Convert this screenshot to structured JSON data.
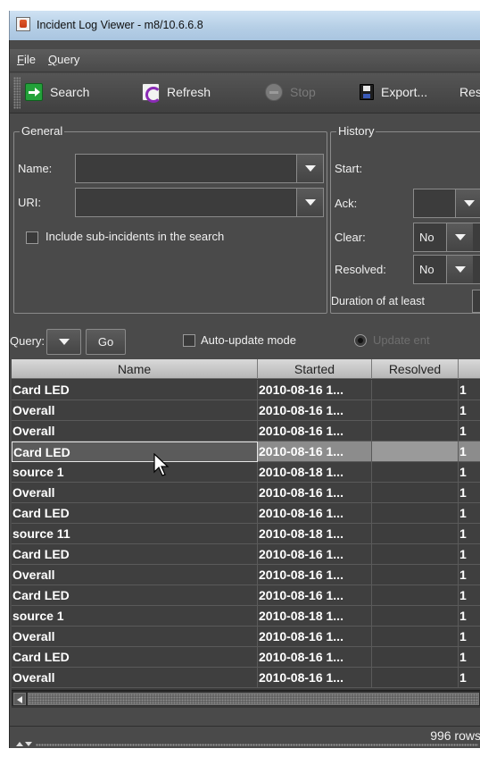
{
  "window": {
    "title": "Incident Log Viewer - m8/10.6.6.8"
  },
  "menu": [
    {
      "label": "File",
      "mnemonic": "F",
      "rest": "ile"
    },
    {
      "label": "Query",
      "mnemonic": "Q",
      "rest": "uery"
    }
  ],
  "toolbar": {
    "search": "Search",
    "refresh": "Refresh",
    "stop": "Stop",
    "export": "Export...",
    "reset": "Res"
  },
  "general": {
    "title": "General",
    "name_label": "Name:",
    "name_value": "",
    "uri_label": "URI:",
    "uri_value": "",
    "include_sub": "Include sub-incidents in the search",
    "include_sub_checked": false
  },
  "history": {
    "title": "History",
    "start_label": "Start:",
    "ack_label": "Ack:",
    "ack_value": "",
    "clear_label": "Clear:",
    "clear_value": "No",
    "resolved_label": "Resolved:",
    "resolved_value": "No",
    "duration_label": "Duration of at least"
  },
  "query": {
    "label": "Query:",
    "go": "Go",
    "auto_update": "Auto-update mode",
    "auto_update_checked": false,
    "update_option": "Update ent"
  },
  "table": {
    "columns": [
      "Name",
      "Started",
      "Resolved",
      ""
    ],
    "rows": [
      {
        "name": "Card LED",
        "started": "2010-08-16 1...",
        "resolved": "",
        "extra": "1"
      },
      {
        "name": "Overall",
        "started": "2010-08-16 1...",
        "resolved": "",
        "extra": "1"
      },
      {
        "name": "Overall",
        "started": "2010-08-16 1...",
        "resolved": "",
        "extra": "1"
      },
      {
        "name": "Card LED",
        "started": "2010-08-16 1...",
        "resolved": "",
        "extra": "1",
        "selected": true
      },
      {
        "name": "source 1",
        "started": "2010-08-18 1...",
        "resolved": "",
        "extra": "1"
      },
      {
        "name": "Overall",
        "started": "2010-08-16 1...",
        "resolved": "",
        "extra": "1"
      },
      {
        "name": "Card LED",
        "started": "2010-08-16 1...",
        "resolved": "",
        "extra": "1"
      },
      {
        "name": "source 11",
        "started": "2010-08-18 1...",
        "resolved": "",
        "extra": "1"
      },
      {
        "name": "Card LED",
        "started": "2010-08-16 1...",
        "resolved": "",
        "extra": "1"
      },
      {
        "name": "Overall",
        "started": "2010-08-16 1...",
        "resolved": "",
        "extra": "1"
      },
      {
        "name": "Card LED",
        "started": "2010-08-16 1...",
        "resolved": "",
        "extra": "1"
      },
      {
        "name": "source 1",
        "started": "2010-08-18 1...",
        "resolved": "",
        "extra": "1"
      },
      {
        "name": "Overall",
        "started": "2010-08-16 1...",
        "resolved": "",
        "extra": "1"
      },
      {
        "name": "Card LED",
        "started": "2010-08-16 1...",
        "resolved": "",
        "extra": "1"
      },
      {
        "name": "Overall",
        "started": "2010-08-16 1...",
        "resolved": "",
        "extra": "1"
      }
    ]
  },
  "status": {
    "row_count": "996 rows"
  },
  "colors": {
    "body": "#4a4a4a",
    "title_bar": "#b6cfe6",
    "selected_row": "#8c8c8c",
    "search_icon": "#23a13a",
    "refresh_icon": "#8a2bb5"
  }
}
